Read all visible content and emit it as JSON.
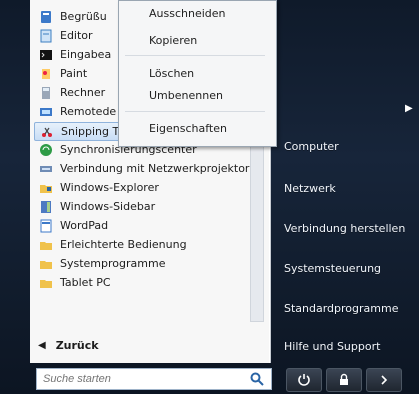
{
  "programs": [
    {
      "label": "Begrüßu",
      "icon": "document-icon"
    },
    {
      "label": "Editor",
      "icon": "notepad-icon"
    },
    {
      "label": "Eingabea",
      "icon": "command-prompt-icon"
    },
    {
      "label": "Paint",
      "icon": "paint-icon"
    },
    {
      "label": "Rechner",
      "icon": "calculator-icon"
    },
    {
      "label": "Remotede",
      "icon": "remote-desktop-icon"
    },
    {
      "label": "Snipping Tool",
      "icon": "scissors-icon",
      "selected": true
    },
    {
      "label": "Synchronisierungscenter",
      "icon": "sync-icon"
    },
    {
      "label": "Verbindung mit Netzwerkprojektor",
      "icon": "network-projector-icon"
    },
    {
      "label": "Windows-Explorer",
      "icon": "folder-explorer-icon"
    },
    {
      "label": "Windows-Sidebar",
      "icon": "sidebar-icon"
    },
    {
      "label": "WordPad",
      "icon": "wordpad-icon"
    },
    {
      "label": "Erleichterte Bedienung",
      "icon": "folder-icon"
    },
    {
      "label": "Systemprogramme",
      "icon": "folder-icon"
    },
    {
      "label": "Tablet PC",
      "icon": "folder-icon"
    }
  ],
  "back_label": "Zurück",
  "context_menu": {
    "items": [
      "Ausschneiden",
      "Kopieren",
      "Löschen",
      "Umbenennen",
      "Eigenschaften"
    ]
  },
  "right_items": [
    "Computer",
    "Netzwerk",
    "Verbindung herstellen",
    "Systemsteuerung",
    "Standardprogramme",
    "Hilfe und Support"
  ],
  "search": {
    "placeholder": "Suche starten"
  },
  "colors": {
    "accent": "#2a64a5",
    "dark": "#17253a"
  }
}
